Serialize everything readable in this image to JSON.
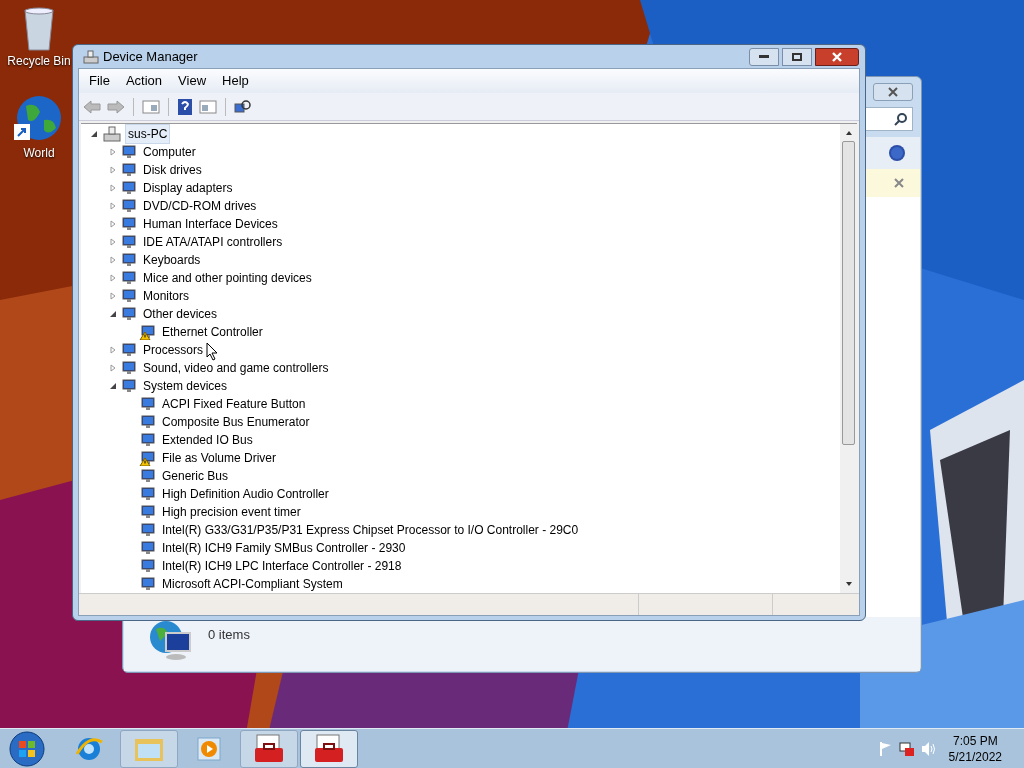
{
  "desktop_icons": [
    {
      "label": "Recycle Bin",
      "kind": "bin"
    },
    {
      "label": "World",
      "kind": "globe"
    }
  ],
  "back_window": {
    "status": "0 items"
  },
  "window": {
    "title": "Device Manager",
    "menu": [
      "File",
      "Action",
      "View",
      "Help"
    ],
    "tree": {
      "label": "sus-PC",
      "expanded": true,
      "selected": true,
      "children": [
        {
          "label": "Computer",
          "expanded": false
        },
        {
          "label": "Disk drives",
          "expanded": false
        },
        {
          "label": "Display adapters",
          "expanded": false
        },
        {
          "label": "DVD/CD-ROM drives",
          "expanded": false
        },
        {
          "label": "Human Interface Devices",
          "expanded": false
        },
        {
          "label": "IDE ATA/ATAPI controllers",
          "expanded": false
        },
        {
          "label": "Keyboards",
          "expanded": false
        },
        {
          "label": "Mice and other pointing devices",
          "expanded": false
        },
        {
          "label": "Monitors",
          "expanded": false
        },
        {
          "label": "Other devices",
          "expanded": true,
          "children": [
            {
              "label": "Ethernet Controller",
              "warning": true
            }
          ]
        },
        {
          "label": "Processors",
          "expanded": false
        },
        {
          "label": "Sound, video and game controllers",
          "expanded": false
        },
        {
          "label": "System devices",
          "expanded": true,
          "children": [
            {
              "label": "ACPI Fixed Feature Button",
              "warning": false
            },
            {
              "label": "Composite Bus Enumerator",
              "warning": false
            },
            {
              "label": "Extended IO Bus",
              "warning": false
            },
            {
              "label": "File as Volume Driver",
              "warning": true
            },
            {
              "label": "Generic Bus",
              "warning": false
            },
            {
              "label": "High Definition Audio Controller",
              "warning": false
            },
            {
              "label": "High precision event timer",
              "warning": false
            },
            {
              "label": "Intel(R) G33/G31/P35/P31 Express Chipset Processor to I/O Controller - 29C0",
              "warning": false
            },
            {
              "label": "Intel(R) ICH9 Family SMBus Controller - 2930",
              "warning": false
            },
            {
              "label": "Intel(R) ICH9 LPC Interface Controller - 2918",
              "warning": false
            },
            {
              "label": "Microsoft ACPI-Compliant System",
              "warning": false
            }
          ]
        }
      ]
    }
  },
  "taskbar": {
    "items": [
      {
        "kind": "ie",
        "selected": false
      },
      {
        "kind": "folder",
        "selected": false
      },
      {
        "kind": "media",
        "selected": false
      },
      {
        "kind": "toolbox",
        "selected": false
      },
      {
        "kind": "toolbox",
        "selected": true
      }
    ],
    "time": "7:05 PM",
    "date": "5/21/2022"
  }
}
